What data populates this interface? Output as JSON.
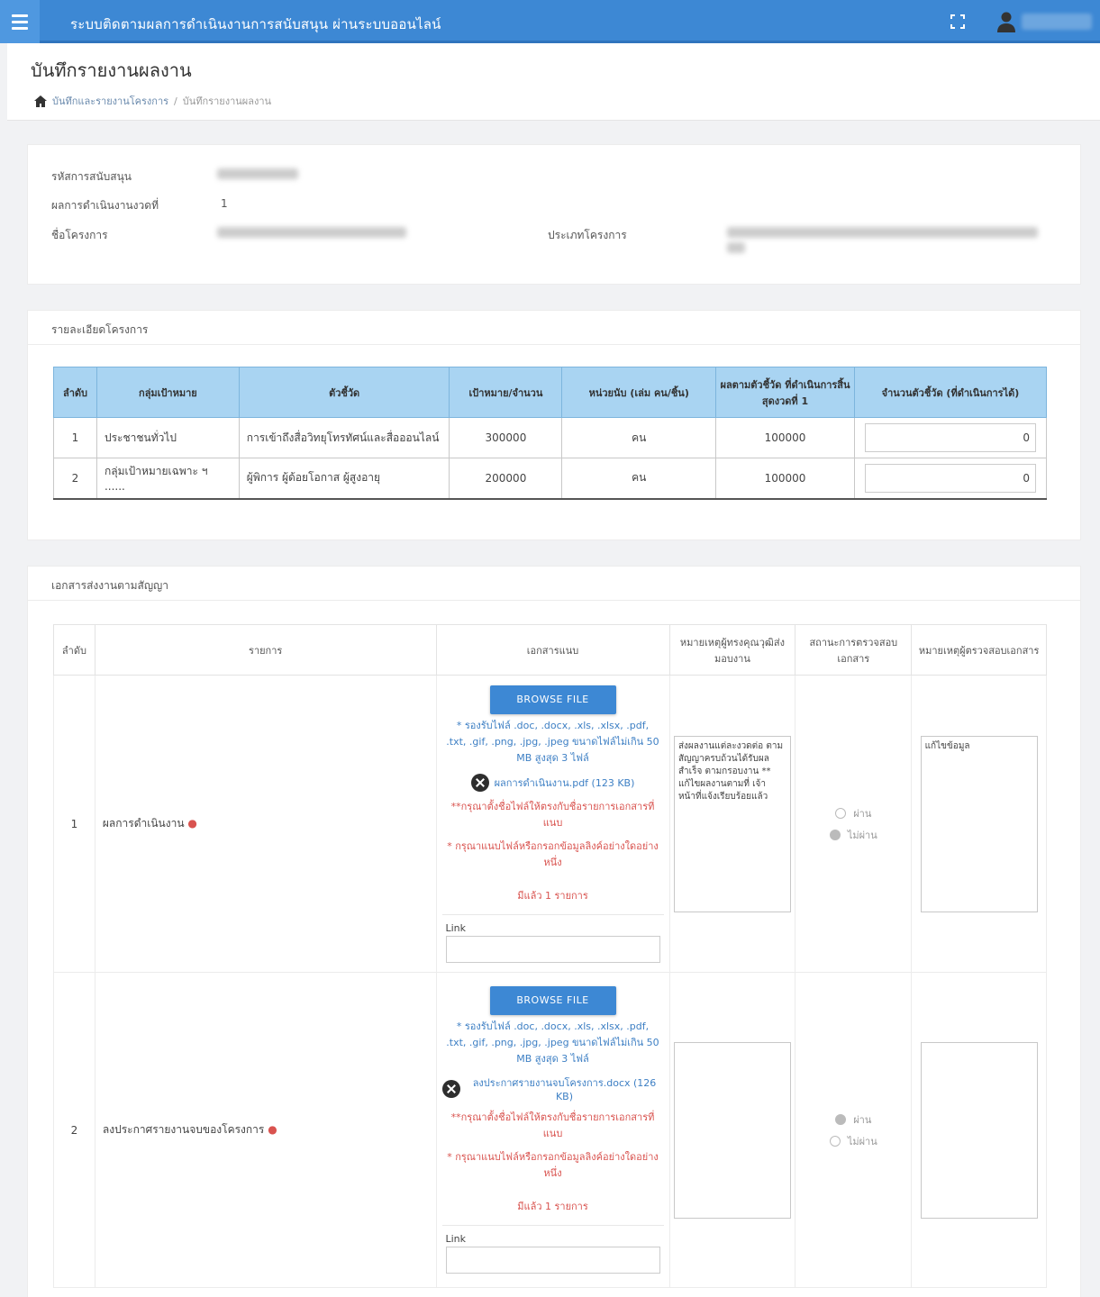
{
  "app": {
    "title": "ระบบติดตามผลการดำเนินงานการสนับสนุน ผ่านระบบออนไลน์"
  },
  "page": {
    "title": "บันทึกรายงานผลงาน",
    "breadcrumb": [
      "บันทึกและรายงานโครงการ",
      "บันทึกรายงานผลงาน"
    ],
    "breadcrumb_sep": "/"
  },
  "info": {
    "fields": [
      {
        "label": "รหัสการสนับสนุน",
        "value": ""
      },
      {
        "label": "ผลการดำเนินงานงวดที่",
        "value": "1"
      },
      {
        "label": "ชื่อโครงการ",
        "value": ""
      },
      {
        "label": "ประเภทโครงการ",
        "value": ""
      }
    ]
  },
  "targets": {
    "title": "รายละเอียดโครงการ",
    "columns": [
      "ลำดับ",
      "กลุ่มเป้าหมาย",
      "ตัวชี้วัด",
      "เป้าหมาย/จำนวน",
      "หน่วยนับ (เล่ม คน/ชิ้น)",
      "ผลตามตัวชี้วัด ที่ดำเนินการสิ้นสุดงวดที่ 1",
      "จำนวนตัวชี้วัด (ที่ดำเนินการได้)"
    ],
    "rows": [
      {
        "no": "1",
        "group": "ประชาชนทั่วไป",
        "indicator": "การเข้าถึงสื่อวิทยุโทรทัศน์และสื่อออนไลน์",
        "target": "300000",
        "unit": "คน",
        "result": "100000",
        "input": "0"
      },
      {
        "no": "2",
        "group": "กลุ่มเป้าหมายเฉพาะ ฯ ......",
        "indicator": "ผู้พิการ ผู้ด้อยโอกาส ผู้สูงอายุ",
        "target": "200000",
        "unit": "คน",
        "result": "100000",
        "input": "0"
      }
    ]
  },
  "docs": {
    "title": "เอกสารส่งงานตามสัญญา",
    "columns": [
      "ลำดับ",
      "รายการ",
      "เอกสารแนบ",
      "หมายเหตุผู้ทรงคุณวุฒิส่งมอบงาน",
      "สถานะการตรวจสอบเอกสาร",
      "หมายเหตุผู้ตรวจสอบเอกสาร"
    ],
    "browse_label": "BROWSE FILE",
    "link_label": "Link",
    "rows": [
      {
        "no": "1",
        "name": "ผลการดำเนินงาน",
        "hint": "* รองรับไฟล์ .doc, .docx, .xls, .xlsx, .pdf, .txt, .gif, .png, .jpg, .jpeg ขนาดไฟล์ไม่เกิน 50 MB สูงสุด 3 ไฟล์",
        "file": "ผลการดำเนินงาน.pdf (123 KB)",
        "warn1": "**กรุณาตั้งชื่อไฟล์ให้ตรงกับชื่อรายการเอกสารที่แนบ",
        "warn2": "* กรุณาแนบไฟล์หรือกรอกข้อมูลลิงค์อย่างใดอย่างหนึ่ง",
        "count": "มีแล้ว 1 รายการ",
        "note": "ส่งผลงานแต่ละงวดต่อ ตามสัญญาครบถ้วนได้รับผลสำเร็จ ตามกรอบงาน ** แก้ไขผลงานตามที่ เจ้าหน้าที่แจ้งเรียบร้อยแล้ว",
        "radio": [
          "ผ่าน",
          "ไม่ผ่าน"
        ],
        "selected": 1,
        "review": "แก้ไขข้อมูล"
      },
      {
        "no": "2",
        "name": "ลงประกาศรายงานจบของโครงการ",
        "hint": "* รองรับไฟล์ .doc, .docx, .xls, .xlsx, .pdf, .txt, .gif, .png, .jpg, .jpeg ขนาดไฟล์ไม่เกิน 50 MB สูงสุด 3 ไฟล์",
        "file": "ลงประกาศรายงานจบโครงการ.docx (126 KB)",
        "warn1": "**กรุณาตั้งชื่อไฟล์ให้ตรงกับชื่อรายการเอกสารที่แนบ",
        "warn2": "* กรุณาแนบไฟล์หรือกรอกข้อมูลลิงค์อย่างใดอย่างหนึ่ง",
        "count": "มีแล้ว 1 รายการ",
        "note": "",
        "radio": [
          "ผ่าน",
          "ไม่ผ่าน"
        ],
        "selected": 0,
        "review": ""
      }
    ]
  },
  "icons": {
    "menu": "hamburger-menu-icon",
    "expand": "fullscreen-icon",
    "user": "user-icon",
    "home": "home-icon",
    "remove": "remove-file-icon"
  },
  "colors": {
    "topbar": "#3d88d4",
    "table_header": "#a9d4f2",
    "hint": "#3d7fc4",
    "warning": "#d9534f"
  }
}
